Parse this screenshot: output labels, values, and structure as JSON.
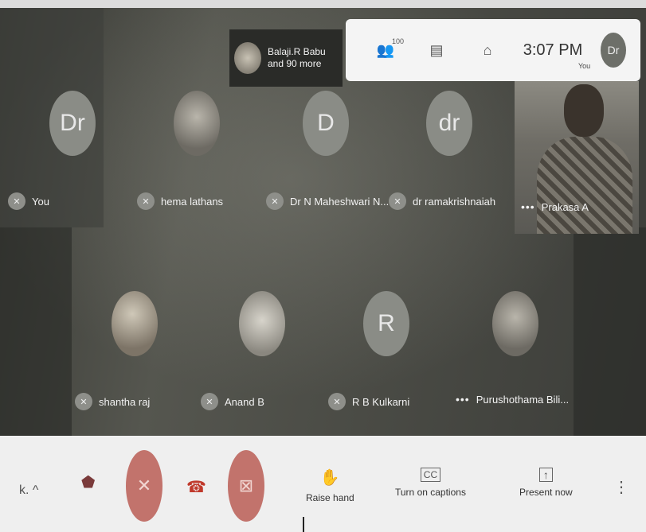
{
  "header": {
    "joined_text_line1": "Balaji.R Babu",
    "joined_text_line2": "and 90 more",
    "people_count": "100",
    "time": "3:07 PM",
    "you_avatar": "Dr",
    "you_label": "You"
  },
  "participants_row1": [
    {
      "initials": "Dr",
      "name": "You"
    },
    {
      "initials": "",
      "name": "hema lathans"
    },
    {
      "initials": "D",
      "name": "Dr N Maheshwari N..."
    },
    {
      "initials": "dr",
      "name": "dr ramakrishnaiah"
    }
  ],
  "presenter": {
    "name": "Prakasa A"
  },
  "participants_row2": [
    {
      "initials": "",
      "name": "shantha raj"
    },
    {
      "initials": "",
      "name": "Anand B"
    },
    {
      "initials": "R",
      "name": "R B Kulkarni"
    },
    {
      "initials": "",
      "name": "Purushothama Bili..."
    }
  ],
  "controls": {
    "left_text": "k. ^",
    "raise_hand": "Raise hand",
    "captions": "Turn on captions",
    "present": "Present now",
    "cc_glyph": "CC"
  }
}
